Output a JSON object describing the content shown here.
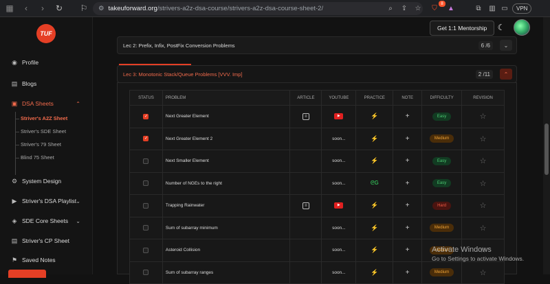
{
  "browser": {
    "url_host": "takeuforward.org",
    "url_path": "/strivers-a2z-dsa-course/strivers-a2z-dsa-course-sheet-2/",
    "vpn_label": "VPN",
    "brave_badge": "8"
  },
  "sidebar": {
    "logo": "TUF",
    "items": [
      {
        "label": "Profile",
        "icon": "user-circle-icon"
      },
      {
        "label": "Blogs",
        "icon": "document-icon"
      },
      {
        "label": "DSA Sheets",
        "icon": "sheet-icon"
      },
      {
        "label": "System Design",
        "icon": "gear-icon"
      },
      {
        "label": "Striver's DSA Playlist",
        "icon": "play-icon"
      },
      {
        "label": "SDE Core Sheets",
        "icon": "layers-icon"
      },
      {
        "label": "Striver's CP Sheet",
        "icon": "sheet-icon"
      },
      {
        "label": "Saved Notes",
        "icon": "bookmark-icon"
      }
    ],
    "sheets": [
      "Striver's A2Z Sheet",
      "Striver's SDE Sheet",
      "Striver's 79 Sheet",
      "Blind 75 Sheet"
    ]
  },
  "header": {
    "mentorship_label": "Get 1:1 Mentorship"
  },
  "lectures": [
    {
      "title": "Lec 2: Prefix, Infix, PostFix Conversion Problems",
      "count": "6 /6"
    },
    {
      "title": "Lec 3: Monotonic Stack/Queue Problems [VVV. Imp]",
      "count": "2 /11"
    }
  ],
  "table": {
    "headers": [
      "STATUS",
      "PROBLEM",
      "ARTICLE",
      "YOUTUBE",
      "PRACTICE",
      "NOTE",
      "DIFFICULTY",
      "REVISION"
    ],
    "rows": [
      {
        "done": true,
        "problem": "Next Greater Element",
        "article": true,
        "youtube": "icon",
        "practice": "cn",
        "difficulty": "Easy"
      },
      {
        "done": true,
        "problem": "Next Greater Element 2",
        "article": false,
        "youtube": "soon...",
        "practice": "cn",
        "difficulty": "Medium"
      },
      {
        "done": false,
        "problem": "Next Smaller Element",
        "article": false,
        "youtube": "soon...",
        "practice": "cn",
        "difficulty": "Easy"
      },
      {
        "done": false,
        "problem": "Number of NGEs to the right",
        "article": false,
        "youtube": "soon...",
        "practice": "gfg",
        "difficulty": "Easy"
      },
      {
        "done": false,
        "problem": "Trapping Rainwater",
        "article": true,
        "youtube": "icon",
        "practice": "cn",
        "difficulty": "Hard"
      },
      {
        "done": false,
        "problem": "Sum of subarray minimum",
        "article": false,
        "youtube": "soon...",
        "practice": "cn",
        "difficulty": "Medium"
      },
      {
        "done": false,
        "problem": "Asteroid Collision",
        "article": false,
        "youtube": "soon...",
        "practice": "cn",
        "difficulty": "Medium"
      },
      {
        "done": false,
        "problem": "Sum of subarray ranges",
        "article": false,
        "youtube": "soon...",
        "practice": "cn",
        "difficulty": "Medium"
      }
    ]
  },
  "watermark": {
    "line1": "Activate Windows",
    "line2": "Go to Settings to activate Windows."
  },
  "colors": {
    "accent": "#e53f25",
    "easy": "#4ccb72",
    "medium": "#f0a437",
    "hard": "#f05a44"
  }
}
